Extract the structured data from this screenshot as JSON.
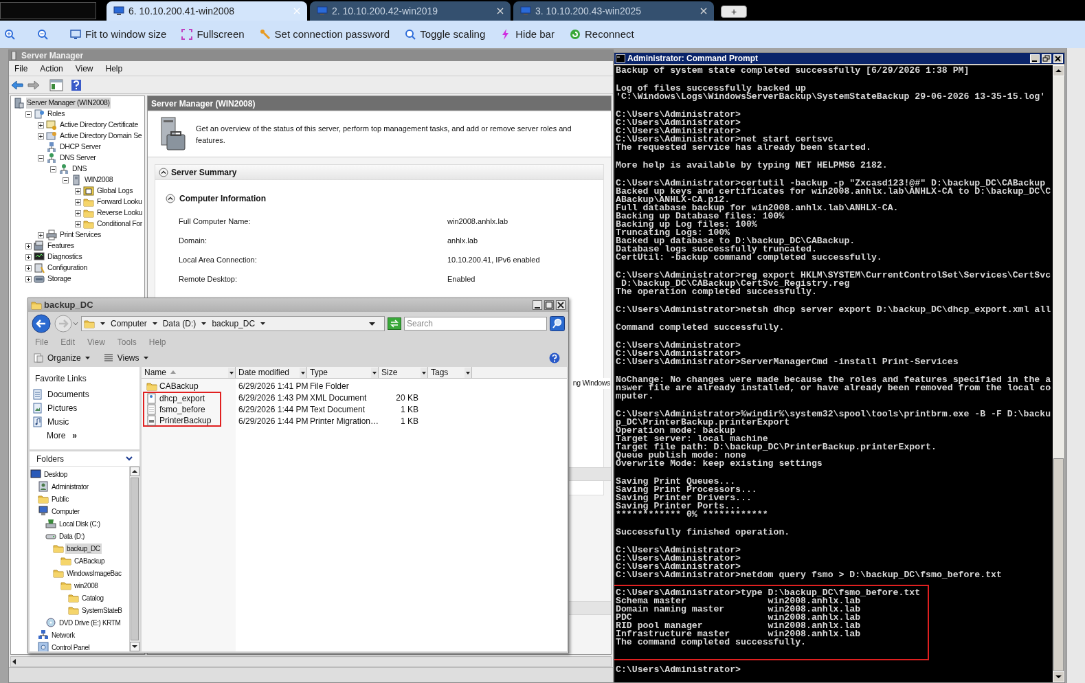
{
  "browser_tabs": [
    {
      "label": "6. 10.10.200.41-win2008",
      "selected": true
    },
    {
      "label": "2. 10.10.200.42-win2019",
      "selected": false
    },
    {
      "label": "3. 10.10.200.43-win2025",
      "selected": false
    }
  ],
  "new_tab": "+",
  "toolbar": [
    {
      "kind": "zoom-in"
    },
    {
      "kind": "zoom-out"
    },
    {
      "kind": "fit",
      "label": "Fit to window size"
    },
    {
      "kind": "fullscreen",
      "label": "Fullscreen"
    },
    {
      "kind": "password",
      "label": "Set connection password"
    },
    {
      "kind": "scaling",
      "label": "Toggle scaling"
    },
    {
      "kind": "hide",
      "label": "Hide bar"
    },
    {
      "kind": "reconnect",
      "label": "Reconnect"
    }
  ],
  "server_manager": {
    "title": "Server Manager",
    "menu": [
      "File",
      "Action",
      "View",
      "Help"
    ],
    "tree": [
      {
        "label": "Server Manager (WIN2008)",
        "kind": "server",
        "selected": true,
        "children": [
          {
            "label": "Roles",
            "kind": "roles",
            "expanded": true,
            "selected": false,
            "children": [
              {
                "label": "Active Directory Certificate",
                "kind": "certificate",
                "expanded": false,
                "selected": false
              },
              {
                "label": "Active Directory Domain Se",
                "kind": "domain",
                "expanded": false,
                "selected": false
              },
              {
                "label": "DHCP Server",
                "kind": "dhcp",
                "selected": false
              },
              {
                "label": "DNS Server",
                "kind": "dns",
                "expanded": true,
                "selected": false,
                "children": [
                  {
                    "label": "DNS",
                    "kind": "dns",
                    "expanded": true,
                    "selected": false,
                    "children": [
                      {
                        "label": "WIN2008",
                        "kind": "tower",
                        "expanded": true,
                        "selected": false,
                        "children": [
                          {
                            "label": "Global Logs",
                            "kind": "log",
                            "expanded": false,
                            "selected": false
                          },
                          {
                            "label": "Forward Looku",
                            "kind": "folder",
                            "expanded": false,
                            "selected": false
                          },
                          {
                            "label": "Reverse Looku",
                            "kind": "folder",
                            "expanded": false,
                            "selected": false
                          },
                          {
                            "label": "Conditional For",
                            "kind": "folder",
                            "expanded": false,
                            "selected": false
                          }
                        ]
                      }
                    ]
                  }
                ]
              },
              {
                "label": "Print Services",
                "kind": "printer",
                "expanded": false,
                "selected": false
              }
            ]
          },
          {
            "label": "Features",
            "kind": "features",
            "expanded": false,
            "selected": false
          },
          {
            "label": "Diagnostics",
            "kind": "diagnostics",
            "expanded": false,
            "selected": false
          },
          {
            "label": "Configuration",
            "kind": "configuration",
            "expanded": false,
            "selected": false
          },
          {
            "label": "Storage",
            "kind": "storage",
            "expanded": false,
            "selected": false
          }
        ]
      }
    ],
    "panel": {
      "header": "Server Manager (WIN2008)",
      "description": "Get an overview of the status of this server, perform top management tasks, and add or remove server roles and features.",
      "summary": {
        "title": "Server Summary",
        "expanded": true
      },
      "computer_information": {
        "title": "Computer Information",
        "expanded": true,
        "rows": [
          {
            "label": "Full Computer Name:",
            "value": "win2008.anhlx.lab"
          },
          {
            "label": "Domain:",
            "value": "anhlx.lab"
          },
          {
            "label": "Local Area Connection:",
            "value": "10.10.200.41, IPv6 enabled"
          },
          {
            "label": "Remote Desktop:",
            "value": "Enabled"
          }
        ]
      },
      "partial_text": "ng Windows"
    }
  },
  "explorer": {
    "title": "backup_DC",
    "breadcrumb": [
      "Computer",
      "Data (D:)",
      "backup_DC"
    ],
    "search_placeholder": "Search",
    "menu": [
      "File",
      "Edit",
      "View",
      "Tools",
      "Help"
    ],
    "commands": [
      "Organize",
      "Views"
    ],
    "favorites_title": "Favorite Links",
    "favorites": [
      {
        "label": "Documents",
        "kind": "documents"
      },
      {
        "label": "Pictures",
        "kind": "pictures"
      },
      {
        "label": "Music",
        "kind": "music"
      }
    ],
    "more": "More",
    "more_glyph": "»",
    "folders_title": "Folders",
    "folders": [
      {
        "label": "Desktop",
        "kind": "desktop",
        "selected": false,
        "children": [
          {
            "label": "Administrator",
            "kind": "user",
            "selected": false
          },
          {
            "label": "Public",
            "kind": "folder",
            "selected": false
          },
          {
            "label": "Computer",
            "kind": "computer",
            "selected": false,
            "children": [
              {
                "label": "Local Disk (C:)",
                "kind": "system-disk",
                "selected": false
              },
              {
                "label": "Data (D:)",
                "kind": "drive",
                "selected": false,
                "children": [
                  {
                    "label": "backup_DC",
                    "kind": "folder",
                    "selected": true,
                    "children": [
                      {
                        "label": "CABackup",
                        "kind": "folder",
                        "selected": false
                      }
                    ]
                  },
                  {
                    "label": "WindowsImageBac",
                    "kind": "folder",
                    "selected": false,
                    "children": [
                      {
                        "label": "win2008",
                        "kind": "folder",
                        "selected": false,
                        "children": [
                          {
                            "label": "Catalog",
                            "kind": "folder",
                            "selected": false
                          },
                          {
                            "label": "SystemStateB",
                            "kind": "folder",
                            "selected": false
                          }
                        ]
                      }
                    ]
                  }
                ]
              },
              {
                "label": "DVD Drive (E:) KRTM",
                "kind": "dvd",
                "selected": false
              }
            ]
          },
          {
            "label": "Network",
            "kind": "network",
            "selected": false
          },
          {
            "label": "Control Panel",
            "kind": "control-panel",
            "selected": false
          }
        ]
      }
    ],
    "columns": [
      {
        "label": "Name",
        "sorted": true
      },
      {
        "label": "Date modified",
        "sorted": false
      },
      {
        "label": "Type",
        "sorted": false
      },
      {
        "label": "Size",
        "sorted": false
      },
      {
        "label": "Tags",
        "sorted": false
      }
    ],
    "files": [
      {
        "name": "CABackup",
        "kind": "folder",
        "date": "6/29/2026 1:41 PM",
        "type": "File Folder",
        "highlighted": false
      },
      {
        "name": "dhcp_export",
        "kind": "xml",
        "date": "6/29/2026 1:43 PM",
        "type": "XML Document",
        "size": "20 KB",
        "highlighted": true
      },
      {
        "name": "fsmo_before",
        "kind": "text",
        "date": "6/29/2026 1:44 PM",
        "type": "Text Document",
        "size": "1 KB",
        "highlighted": true
      },
      {
        "name": "PrinterBackup",
        "kind": "printer-file",
        "date": "6/29/2026 1:44 PM",
        "type": "Printer Migration…",
        "size": "1 KB",
        "highlighted": true
      }
    ]
  },
  "console": {
    "title": "Administrator: Command Prompt",
    "blocks": [
      {
        "highlighted": false,
        "lines": [
          "Backup of system state completed successfully [6/29/2026 1:38 PM]"
        ]
      },
      {
        "highlighted": false,
        "lines": [
          "Log of files successfully backed up",
          "'C:\\Windows\\Logs\\WindowsServerBackup\\SystemStateBackup 29-06-2026 13-35-15.log'"
        ]
      },
      {
        "highlighted": false,
        "lines": [
          "C:\\Users\\Administrator>",
          "C:\\Users\\Administrator>",
          "C:\\Users\\Administrator>",
          "C:\\Users\\Administrator>net start certsvc",
          "The requested service has already been started."
        ]
      },
      {
        "highlighted": false,
        "lines": [
          "More help is available by typing NET HELPMSG 2182."
        ]
      },
      {
        "highlighted": false,
        "lines": [
          "C:\\Users\\Administrator>certutil -backup -p \"Zxcasd123!@#\" D:\\backup_DC\\CABackup",
          "Backed up keys and certificates for win2008.anhlx.lab\\ANHLX-CA to D:\\backup_DC\\C",
          "ABackup\\ANHLX-CA.p12.",
          "Full database backup for win2008.anhlx.lab\\ANHLX-CA.",
          "Backing up Database files: 100%",
          "Backing up Log files: 100%",
          "Truncating Logs: 100%",
          "Backed up database to D:\\backup_DC\\CABackup.",
          "Database logs successfully truncated.",
          "CertUtil: -backup command completed successfully."
        ]
      },
      {
        "highlighted": false,
        "lines": [
          "C:\\Users\\Administrator>reg export HKLM\\SYSTEM\\CurrentControlSet\\Services\\CertSvc",
          " D:\\backup_DC\\CABackup\\CertSvc_Registry.reg",
          "The operation completed successfully."
        ]
      },
      {
        "highlighted": false,
        "lines": [
          "C:\\Users\\Administrator>netsh dhcp server export D:\\backup_DC\\dhcp_export.xml all"
        ]
      },
      {
        "highlighted": false,
        "lines": [
          "Command completed successfully."
        ]
      },
      {
        "highlighted": false,
        "lines": [
          "C:\\Users\\Administrator>",
          "C:\\Users\\Administrator>",
          "C:\\Users\\Administrator>ServerManagerCmd -install Print-Services"
        ]
      },
      {
        "highlighted": false,
        "lines": [
          "NoChange: No changes were made because the roles and features specified in the a",
          "nswer file are already installed, or have already been removed from the local co",
          "mputer."
        ]
      },
      {
        "highlighted": false,
        "lines": [
          "C:\\Users\\Administrator>%windir%\\system32\\spool\\tools\\printbrm.exe -B -F D:\\backu",
          "p_DC\\PrinterBackup.printerExport",
          "Operation mode: backup",
          "Target server: local machine",
          "Target file path: D:\\backup_DC\\PrinterBackup.printerExport.",
          "Queue publish mode: none",
          "Overwrite Mode: keep existing settings"
        ]
      },
      {
        "highlighted": false,
        "lines": [
          "Saving Print Queues...",
          "Saving Print Processors...",
          "Saving Printer Drivers...",
          "Saving Printer Ports...",
          "************ 0% ************"
        ]
      },
      {
        "highlighted": false,
        "lines": [
          "Successfully finished operation."
        ]
      },
      {
        "highlighted": false,
        "lines": [
          "C:\\Users\\Administrator>",
          "C:\\Users\\Administrator>",
          "C:\\Users\\Administrator>",
          "C:\\Users\\Administrator>netdom query fsmo > D:\\backup_DC\\fsmo_before.txt"
        ]
      },
      {
        "highlighted": true,
        "lines": [
          "C:\\Users\\Administrator>type D:\\backup_DC\\fsmo_before.txt",
          "Schema master               win2008.anhlx.lab",
          "Domain naming master        win2008.anhlx.lab",
          "PDC                         win2008.anhlx.lab",
          "RID pool manager            win2008.anhlx.lab",
          "Infrastructure master       win2008.anhlx.lab",
          "The command completed successfully."
        ]
      },
      {
        "highlighted": false,
        "lines": [
          "C:\\Users\\Administrator>"
        ]
      }
    ]
  }
}
